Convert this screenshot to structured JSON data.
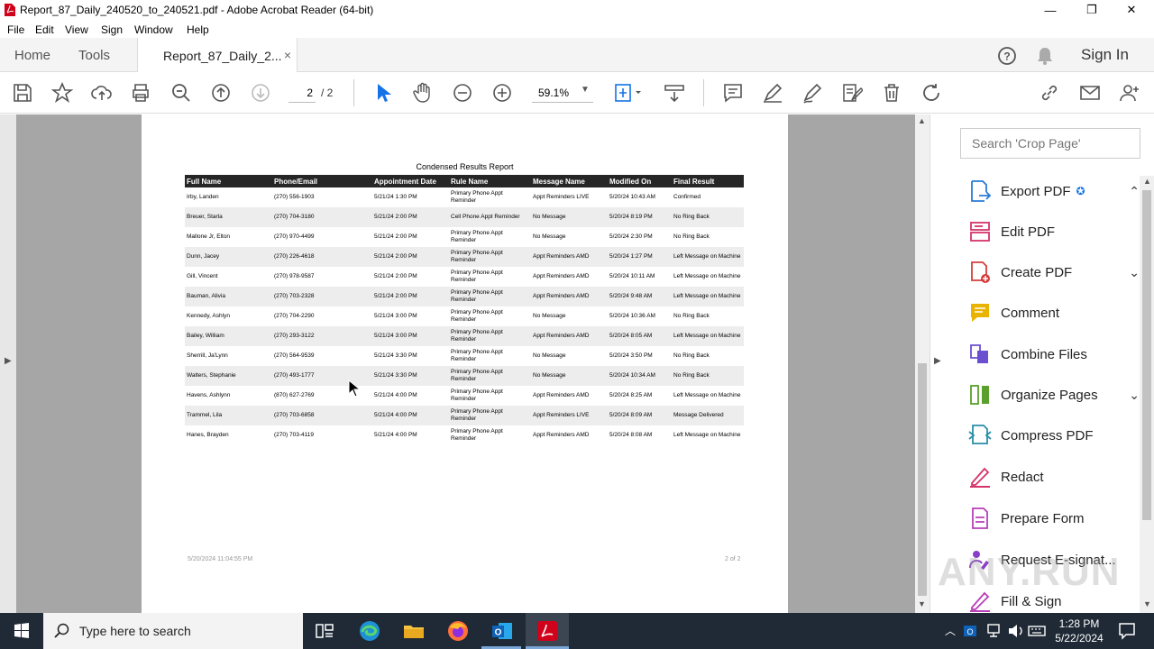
{
  "window": {
    "title": "Report_87_Daily_240520_to_240521.pdf - Adobe Acrobat Reader (64-bit)",
    "minimize": "—",
    "restore": "❐",
    "close": "✕"
  },
  "menu": [
    "File",
    "Edit",
    "View",
    "Sign",
    "Window",
    "Help"
  ],
  "tabs": {
    "home": "Home",
    "tools": "Tools",
    "document": "Report_87_Daily_2...",
    "close": "×",
    "sign_in": "Sign In"
  },
  "toolbar": {
    "current_page": "2",
    "total_pages": "/  2",
    "zoom": "59.1%"
  },
  "report": {
    "title": "Condensed Results Report",
    "columns": [
      "Full Name",
      "Phone/Email",
      "Appointment Date",
      "Rule Name",
      "Message Name",
      "Modified On",
      "Final Result"
    ],
    "rows": [
      [
        "Irby, Landen",
        "(270) 556-1903",
        "5/21/24 1:30 PM",
        "Primary Phone Appt Reminder",
        "Appt Reminders LIVE",
        "5/20/24 10:43 AM",
        "Confirmed"
      ],
      [
        "Breuer, Starla",
        "(270) 704-3180",
        "5/21/24 2:00 PM",
        "Cell Phone Appt Reminder",
        "No Message",
        "5/20/24 8:19 PM",
        "No Ring Back"
      ],
      [
        "Mallone Jr, Elton",
        "(270) 970-4499",
        "5/21/24 2:00 PM",
        "Primary Phone Appt Reminder",
        "No Message",
        "5/20/24 2:30 PM",
        "No Ring Back"
      ],
      [
        "Dunn, Jacey",
        "(270) 226-4618",
        "5/21/24 2:00 PM",
        "Primary Phone Appt Reminder",
        "Appt Reminders AMD",
        "5/20/24 1:27 PM",
        "Left Message on Machine"
      ],
      [
        "Gill, Vincent",
        "(270) 978-9587",
        "5/21/24 2:00 PM",
        "Primary Phone Appt Reminder",
        "Appt Reminders AMD",
        "5/20/24 10:11 AM",
        "Left Message on Machine"
      ],
      [
        "Bauman, Alivia",
        "(270) 703-2328",
        "5/21/24 2:00 PM",
        "Primary Phone Appt Reminder",
        "Appt Reminders AMD",
        "5/20/24 9:48 AM",
        "Left Message on Machine"
      ],
      [
        "Kennedy, Ashlyn",
        "(270) 704-2290",
        "5/21/24 3:00 PM",
        "Primary Phone Appt Reminder",
        "No Message",
        "5/20/24 10:36 AM",
        "No Ring Back"
      ],
      [
        "Bailey, William",
        "(270) 293-3122",
        "5/21/24 3:00 PM",
        "Primary Phone Appt Reminder",
        "Appt Reminders AMD",
        "5/20/24 8:05 AM",
        "Left Message on Machine"
      ],
      [
        "Sherrill, Ja'Lynn",
        "(270) 564-9539",
        "5/21/24 3:30 PM",
        "Primary Phone Appt Reminder",
        "No Message",
        "5/20/24 3:50 PM",
        "No Ring Back"
      ],
      [
        "Walters, Stephanie",
        "(270) 493-1777",
        "5/21/24 3:30 PM",
        "Primary Phone Appt Reminder",
        "No Message",
        "5/20/24 10:34 AM",
        "No Ring Back"
      ],
      [
        "Havens, Ashlynn",
        "(870) 627-2769",
        "5/21/24 4:00 PM",
        "Primary Phone Appt Reminder",
        "Appt Reminders AMD",
        "5/20/24 8:25 AM",
        "Left Message on Machine"
      ],
      [
        "Trammel, Lila",
        "(270) 703-6858",
        "5/21/24 4:00 PM",
        "Primary Phone Appt Reminder",
        "Appt Reminders LIVE",
        "5/20/24 8:09 AM",
        "Message Delivered"
      ],
      [
        "Hanes, Brayden",
        "(270) 703-4119",
        "5/21/24 4:00 PM",
        "Primary Phone Appt Reminder",
        "Appt Reminders AMD",
        "5/20/24 8:08 AM",
        "Left Message on Machine"
      ]
    ],
    "footer_left": "5/20/2024 11:04:55 PM",
    "footer_right": "2 of 2"
  },
  "right_panel": {
    "search_placeholder": "Search 'Crop Page'",
    "tools": [
      {
        "label": "Export PDF",
        "icon": "export-pdf-icon",
        "color": "#2a7bd4",
        "chevron": "⌃"
      },
      {
        "label": "Edit PDF",
        "icon": "edit-pdf-icon",
        "color": "#d6336c",
        "chevron": ""
      },
      {
        "label": "Create PDF",
        "icon": "create-pdf-icon",
        "color": "#d63c3c",
        "chevron": "⌄"
      },
      {
        "label": "Comment",
        "icon": "comment-icon",
        "color": "#e8b400",
        "chevron": ""
      },
      {
        "label": "Combine Files",
        "icon": "combine-files-icon",
        "color": "#6a4fd1",
        "chevron": ""
      },
      {
        "label": "Organize Pages",
        "icon": "organize-pages-icon",
        "color": "#5aa02c",
        "chevron": "⌄"
      },
      {
        "label": "Compress PDF",
        "icon": "compress-pdf-icon",
        "color": "#2a8fa8",
        "chevron": ""
      },
      {
        "label": "Redact",
        "icon": "redact-icon",
        "color": "#d6336c",
        "chevron": ""
      },
      {
        "label": "Prepare Form",
        "icon": "prepare-form-icon",
        "color": "#b83fb8",
        "chevron": ""
      },
      {
        "label": "Request E-signat...",
        "icon": "request-esign-icon",
        "color": "#8a3fc8",
        "chevron": ""
      },
      {
        "label": "Fill & Sign",
        "icon": "fill-sign-icon",
        "color": "#b83fb8",
        "chevron": ""
      }
    ],
    "watermark": "ANY.RUN"
  },
  "taskbar": {
    "search_placeholder": "Type here to search",
    "time": "1:28 PM",
    "date": "5/22/2024"
  }
}
